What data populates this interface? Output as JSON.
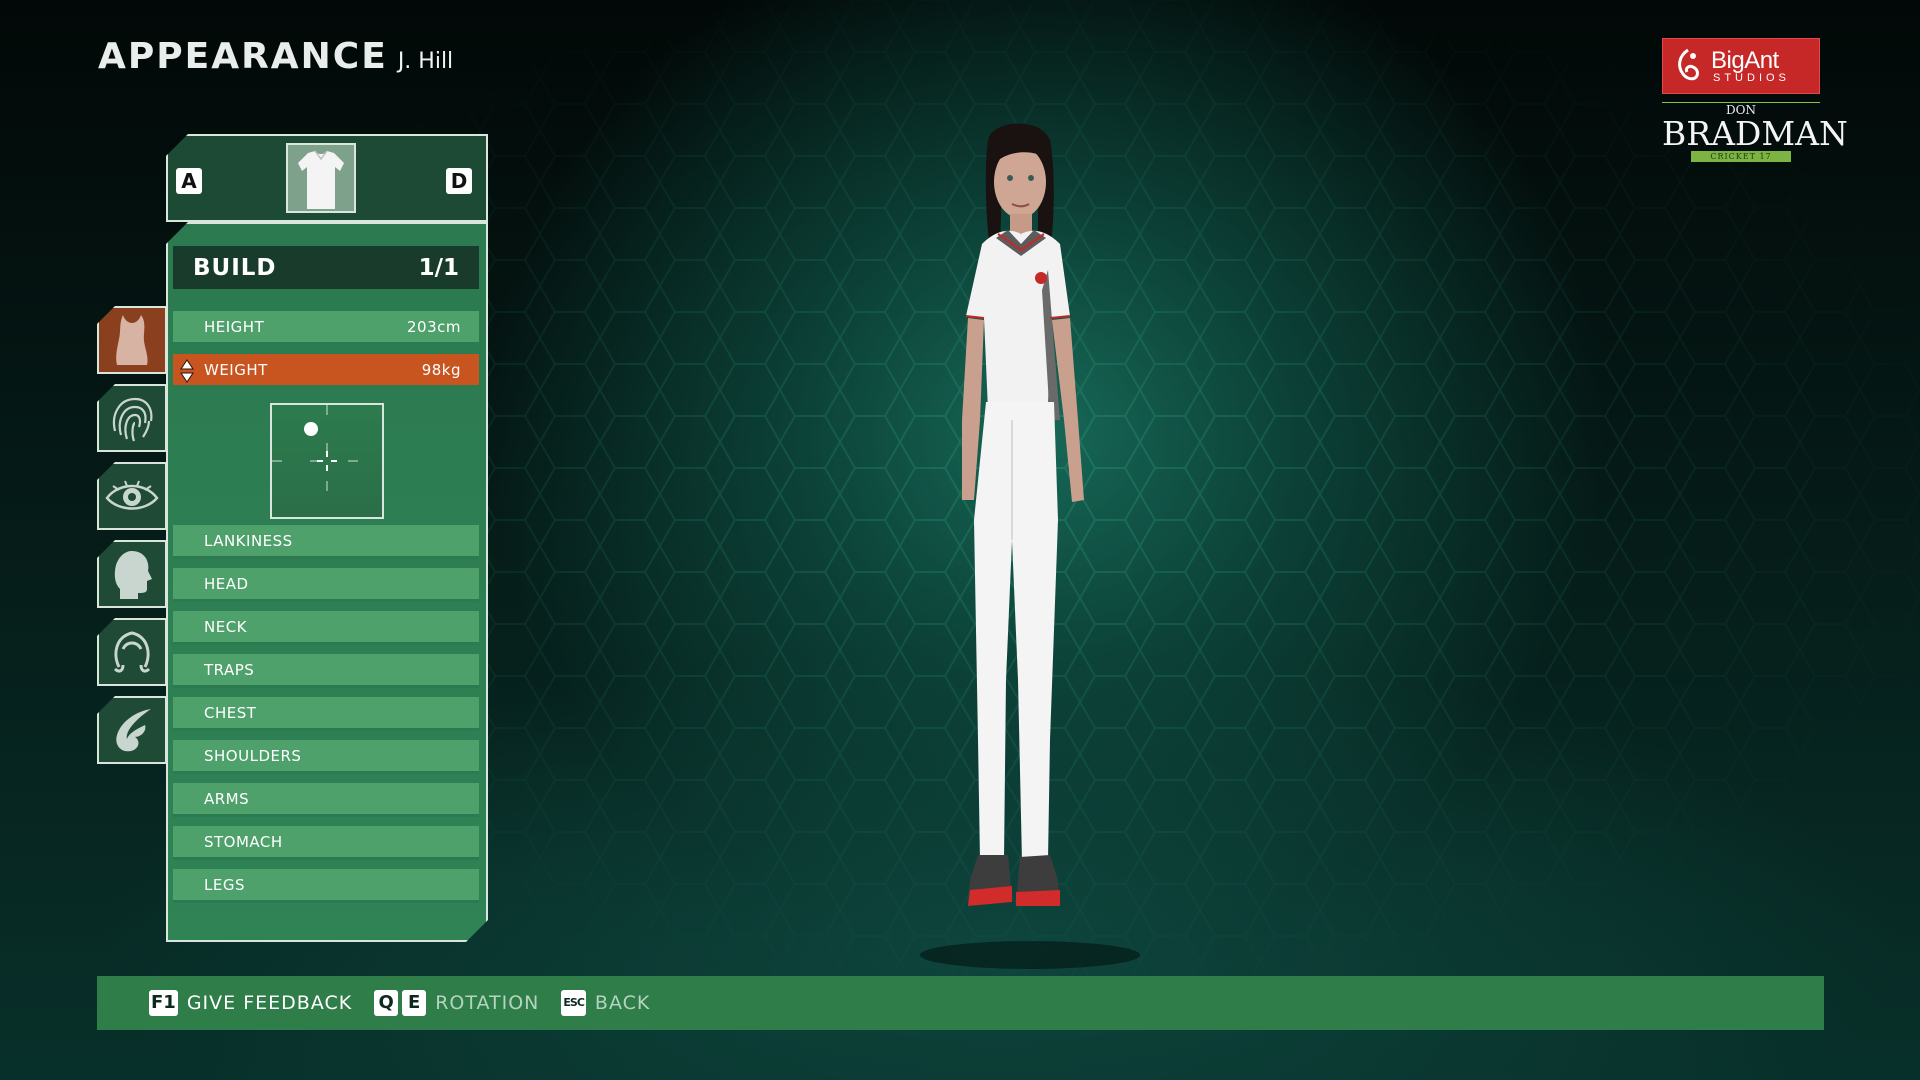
{
  "header": {
    "title": "APPEARANCE",
    "player_name": "J. Hill"
  },
  "logo": {
    "studio": "BigAnt",
    "studio_sub": "STUDIOS",
    "game_top": "DON",
    "game_name": "BRADMAN",
    "game_sub": "CRICKET 17"
  },
  "panel": {
    "prev_key": "A",
    "next_key": "D",
    "thumbnail_icon": "polo-shirt-icon",
    "section": {
      "label": "BUILD",
      "page": "1/1"
    },
    "rows": [
      {
        "label": "HEIGHT",
        "value": "203cm"
      },
      {
        "label": "WEIGHT",
        "value": "98kg",
        "selected": true
      },
      {
        "label": "LANKINESS",
        "value": ""
      },
      {
        "label": "HEAD",
        "value": ""
      },
      {
        "label": "NECK",
        "value": ""
      },
      {
        "label": "TRAPS",
        "value": ""
      },
      {
        "label": "CHEST",
        "value": ""
      },
      {
        "label": "SHOULDERS",
        "value": ""
      },
      {
        "label": "ARMS",
        "value": ""
      },
      {
        "label": "STOMACH",
        "value": ""
      },
      {
        "label": "LEGS",
        "value": ""
      }
    ]
  },
  "side_tabs": [
    "body-icon",
    "fingerprint-icon",
    "eye-icon",
    "head-icon",
    "hair-icon",
    "tattoo-icon"
  ],
  "footer": {
    "hints": [
      {
        "keys": [
          "F1"
        ],
        "label": "GIVE FEEDBACK"
      },
      {
        "keys": [
          "Q",
          "E"
        ],
        "label": "ROTATION"
      },
      {
        "keys": [
          "ESC"
        ],
        "label": "BACK"
      }
    ]
  },
  "colors": {
    "accent_selected": "#c85520",
    "panel_green": "#4fa16c",
    "footer_green": "#2f7d49",
    "logo_red": "#c62828"
  }
}
